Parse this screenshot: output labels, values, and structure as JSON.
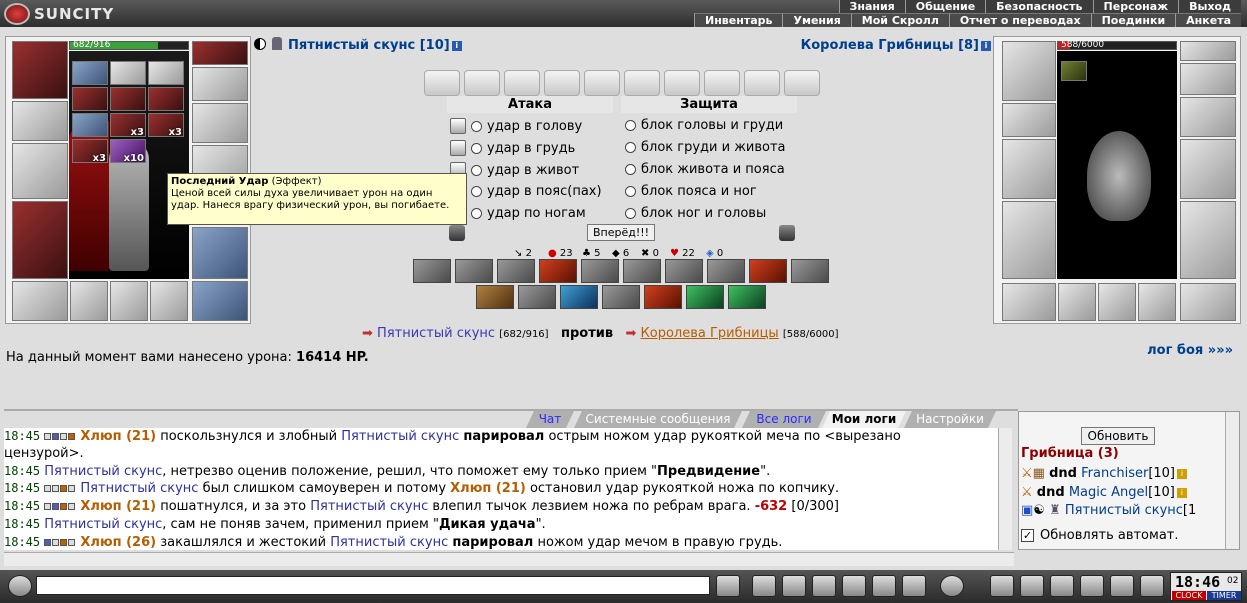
{
  "logo": {
    "text": "SUNCITY"
  },
  "nav": {
    "row1": [
      "Знания",
      "Общение",
      "Безопасность",
      "Персонаж",
      "Выход"
    ],
    "row2": [
      "Инвентарь",
      "Умения",
      "Мой Скролл",
      "Отчет о переводах",
      "Поединки",
      "Анкета"
    ]
  },
  "left_player": {
    "name": "Пятнистый скунс",
    "level": "[10]",
    "hp": "682/916",
    "hp_fraction": 0.745
  },
  "right_player": {
    "name": "Королева Грибницы",
    "level": "[8]",
    "hp": "588/6000",
    "hp_fraction": 0.098
  },
  "inventory_badges": [
    "x3",
    "x3",
    "x3",
    "x10"
  ],
  "tooltip": {
    "title": "Последний Удар",
    "kind": " (Эффект)",
    "text": "Ценой всей силы духа увеличивает урон на один удар. Нанеся врагу физический урон, вы погибаете."
  },
  "battle": {
    "attack_header": "Атака",
    "defense_header": "Защита",
    "attack": [
      "удар в голову",
      "удар в грудь",
      "удар в живот",
      "удар в пояс(пах)",
      "удар по ногам"
    ],
    "defense": [
      "блок головы и груди",
      "блок груди и живота",
      "блок живота и пояса",
      "блок пояса и ног",
      "блок ног и головы"
    ],
    "forward_button": "Вперёд!!!",
    "stats": [
      "2",
      "23",
      "5",
      "6",
      "0",
      "22",
      "0"
    ]
  },
  "versus": {
    "left_name": "Пятнистый скунс",
    "left_hp": "[682/916]",
    "word": "против",
    "right_name": "Королева Грибницы",
    "right_hp": "[588/6000]"
  },
  "damage": {
    "label": "На данный момент вами нанесено урона: ",
    "value": "16414 HP."
  },
  "log_link": "лог боя »»»",
  "tabs": [
    "Чат",
    "Системные сообщения",
    "Все логи",
    "Мои логи",
    "Настройки"
  ],
  "chat": [
    {
      "time": "18:45",
      "a": "Хлюп (21)",
      "t1": " поскользнулся и злобный ",
      "b": "Пятнистый скунс",
      "t2": " ",
      "h": "парировал",
      "t3": " острым ножом удар рукояткой меча по <вырезано"
    },
    {
      "time": "",
      "a": "",
      "t1": "цензурой>.",
      "b": "",
      "t2": "",
      "h": "",
      "t3": ""
    },
    {
      "time": "18:45",
      "a": "",
      "t1": ", нетрезво оценив положение, решил, что поможет ему только прием \"",
      "b": "Пятнистый скунс",
      "t2": "",
      "h": "Предвидение",
      "t3": "\"."
    },
    {
      "time": "18:45",
      "a": "",
      "t1": " был слишком самоуверен и потому ",
      "b": "Пятнистый скунс",
      "t2": "",
      "h": "Хлюп (21)",
      "t3": " остановил удар рукояткой ножа по копчику."
    },
    {
      "time": "18:45",
      "a": "Хлюп (21)",
      "t1": " пошатнулся, и за это ",
      "b": "Пятнистый скунс",
      "t2": " влепил тычок лезвием ножа по ребрам врага. ",
      "h": "-632",
      "t3": " [0/300]"
    },
    {
      "time": "18:45",
      "a": "",
      "t1": ", сам не поняв зачем, применил прием \"",
      "b": "Пятнистый скунс",
      "t2": "",
      "h": "Дикая удача",
      "t3": "\"."
    },
    {
      "time": "18:45",
      "a": "Хлюп (26)",
      "t1": " закашлялся и жестокий ",
      "b": "Пятнистый скунс",
      "t2": " ",
      "h": "парировал",
      "t3": " ножом удар мечом в правую грудь."
    }
  ],
  "userlist": {
    "refresh_button": "Обновить",
    "group_title": "Грибница (3)",
    "users": [
      {
        "clan": "dnd",
        "name": "Franchiser",
        "level": "[10]"
      },
      {
        "clan": "dnd",
        "name": "Magic Angel",
        "level": "[10]"
      },
      {
        "clan": "",
        "name": "Пятнистый скунс",
        "level": "[1"
      }
    ],
    "auto_refresh": "Обновлять автомат."
  },
  "clock": {
    "time": "18:46",
    "seconds": "02",
    "clock_label": "CLOCK",
    "timer_label": "TIMER"
  },
  "colors": {
    "accent_blue": "#003e8c",
    "hp_green": "#3ca03c",
    "hp_red": "#c02020",
    "nick_orange": "#b85c00"
  }
}
